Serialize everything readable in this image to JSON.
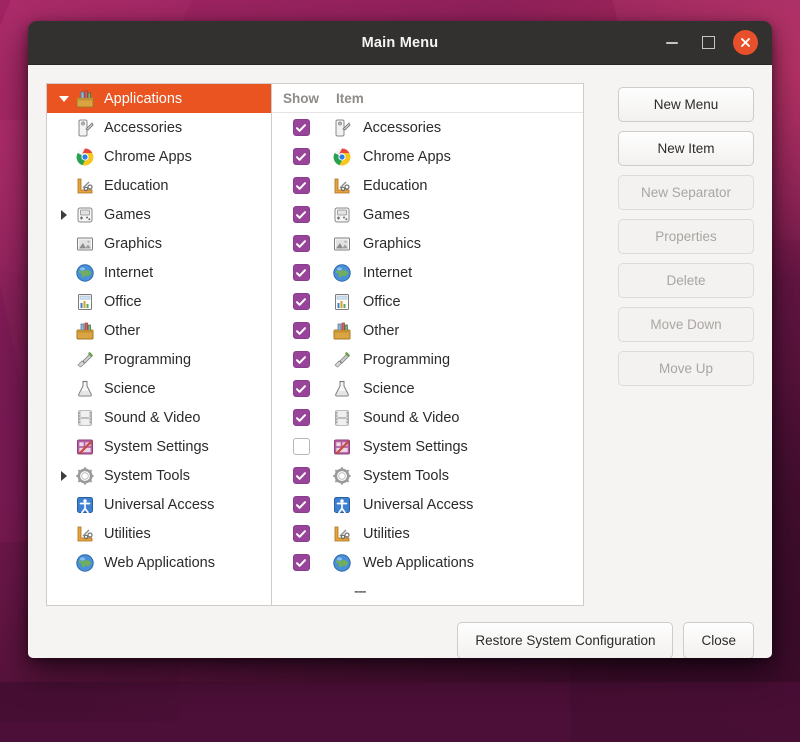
{
  "window": {
    "title": "Main Menu",
    "controls": {
      "minimize": "minimize",
      "maximize": "maximize",
      "close": "close"
    },
    "accent_orange": "#e95420",
    "checkbox_purple": "#97449a",
    "titlebar_color": "#333130"
  },
  "tree": {
    "root": {
      "label": "Applications",
      "icon": "toolbox-icon",
      "expanded": true,
      "selected": true
    },
    "items": [
      {
        "label": "Accessories",
        "icon": "accessories-icon",
        "expandable": false
      },
      {
        "label": "Chrome Apps",
        "icon": "chrome-icon",
        "expandable": false
      },
      {
        "label": "Education",
        "icon": "education-icon",
        "expandable": false
      },
      {
        "label": "Games",
        "icon": "games-icon",
        "expandable": true
      },
      {
        "label": "Graphics",
        "icon": "graphics-icon",
        "expandable": false
      },
      {
        "label": "Internet",
        "icon": "internet-icon",
        "expandable": false
      },
      {
        "label": "Office",
        "icon": "office-icon",
        "expandable": false
      },
      {
        "label": "Other",
        "icon": "other-icon",
        "expandable": false
      },
      {
        "label": "Programming",
        "icon": "programming-icon",
        "expandable": false
      },
      {
        "label": "Science",
        "icon": "science-icon",
        "expandable": false
      },
      {
        "label": "Sound & Video",
        "icon": "sound-video-icon",
        "expandable": false
      },
      {
        "label": "System Settings",
        "icon": "system-settings-icon",
        "expandable": false
      },
      {
        "label": "System Tools",
        "icon": "system-tools-icon",
        "expandable": true
      },
      {
        "label": "Universal Access",
        "icon": "universal-access-icon",
        "expandable": false
      },
      {
        "label": "Utilities",
        "icon": "utilities-icon",
        "expandable": false
      },
      {
        "label": "Web Applications",
        "icon": "web-applications-icon",
        "expandable": false
      }
    ]
  },
  "list": {
    "headers": {
      "show": "Show",
      "item": "Item"
    },
    "rows": [
      {
        "label": "Accessories",
        "icon": "accessories-icon",
        "checked": true
      },
      {
        "label": "Chrome Apps",
        "icon": "chrome-icon",
        "checked": true
      },
      {
        "label": "Education",
        "icon": "education-icon",
        "checked": true
      },
      {
        "label": "Games",
        "icon": "games-icon",
        "checked": true
      },
      {
        "label": "Graphics",
        "icon": "graphics-icon",
        "checked": true
      },
      {
        "label": "Internet",
        "icon": "internet-icon",
        "checked": true
      },
      {
        "label": "Office",
        "icon": "office-icon",
        "checked": true
      },
      {
        "label": "Other",
        "icon": "other-icon",
        "checked": true
      },
      {
        "label": "Programming",
        "icon": "programming-icon",
        "checked": true
      },
      {
        "label": "Science",
        "icon": "science-icon",
        "checked": true
      },
      {
        "label": "Sound & Video",
        "icon": "sound-video-icon",
        "checked": true
      },
      {
        "label": "System Settings",
        "icon": "system-settings-icon",
        "checked": false
      },
      {
        "label": "System Tools",
        "icon": "system-tools-icon",
        "checked": true
      },
      {
        "label": "Universal Access",
        "icon": "universal-access-icon",
        "checked": true
      },
      {
        "label": "Utilities",
        "icon": "utilities-icon",
        "checked": true
      },
      {
        "label": "Web Applications",
        "icon": "web-applications-icon",
        "checked": true
      }
    ],
    "separator_label": "---"
  },
  "side_buttons": [
    {
      "label": "New Menu",
      "enabled": true
    },
    {
      "label": "New Item",
      "enabled": true
    },
    {
      "label": "New Separator",
      "enabled": false
    },
    {
      "label": "Properties",
      "enabled": false
    },
    {
      "label": "Delete",
      "enabled": false
    },
    {
      "label": "Move Down",
      "enabled": false
    },
    {
      "label": "Move Up",
      "enabled": false
    }
  ],
  "footer": {
    "restore_label": "Restore System Configuration",
    "close_label": "Close"
  }
}
